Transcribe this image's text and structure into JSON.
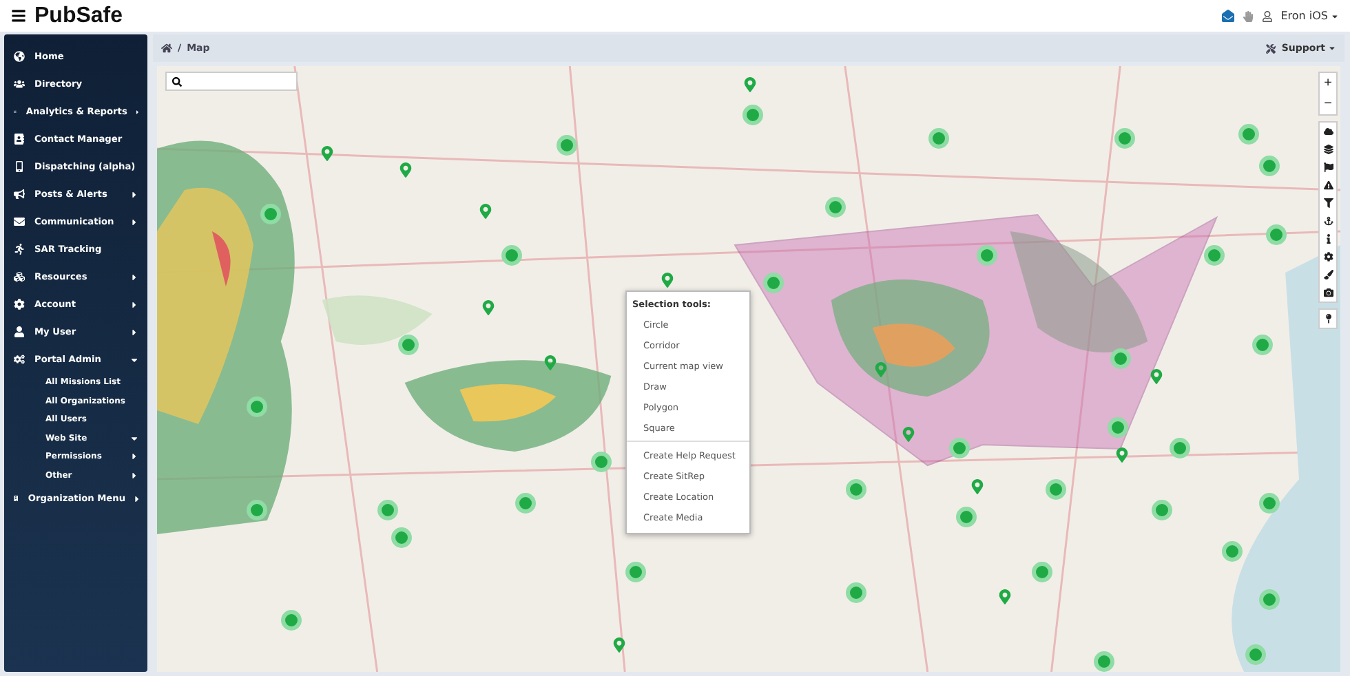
{
  "header": {
    "logo": "PubSafe",
    "user": "Eron iOS"
  },
  "sidebar": {
    "items": [
      {
        "label": "Home",
        "has_submenu": false
      },
      {
        "label": "Directory",
        "has_submenu": false
      },
      {
        "label": "Analytics & Reports",
        "has_submenu": true,
        "expanded": false
      },
      {
        "label": "Contact Manager",
        "has_submenu": false
      },
      {
        "label": "Dispatching (alpha)",
        "has_submenu": false
      },
      {
        "label": "Posts & Alerts",
        "has_submenu": true,
        "expanded": false
      },
      {
        "label": "Communication",
        "has_submenu": true,
        "expanded": false
      },
      {
        "label": "SAR Tracking",
        "has_submenu": false
      },
      {
        "label": "Resources",
        "has_submenu": true,
        "expanded": false
      },
      {
        "label": "Account",
        "has_submenu": true,
        "expanded": false
      },
      {
        "label": "My User",
        "has_submenu": true,
        "expanded": false
      },
      {
        "label": "Portal Admin",
        "has_submenu": true,
        "expanded": true,
        "children": [
          {
            "label": "All Missions List",
            "has_submenu": false
          },
          {
            "label": "All Organizations",
            "has_submenu": false
          },
          {
            "label": "All Users",
            "has_submenu": false
          },
          {
            "label": "Web Site",
            "has_submenu": true,
            "expanded": true
          },
          {
            "label": "Permissions",
            "has_submenu": true,
            "expanded": false
          },
          {
            "label": "Other",
            "has_submenu": true,
            "expanded": false
          }
        ]
      },
      {
        "label": "Organization Menu",
        "has_submenu": true,
        "expanded": false
      }
    ]
  },
  "breadcrumb": {
    "separator": "/",
    "current": "Map",
    "support": "Support"
  },
  "map": {
    "kind": "picture",
    "context_menu": {
      "title": "Selection tools:",
      "groups": [
        [
          "Circle",
          "Corridor",
          "Current map view",
          "Draw",
          "Polygon",
          "Square"
        ],
        [
          "Create Help Request",
          "Create SitRep",
          "Create Location",
          "Create Media"
        ]
      ]
    },
    "zoom": {
      "in": "+",
      "out": "−"
    }
  }
}
